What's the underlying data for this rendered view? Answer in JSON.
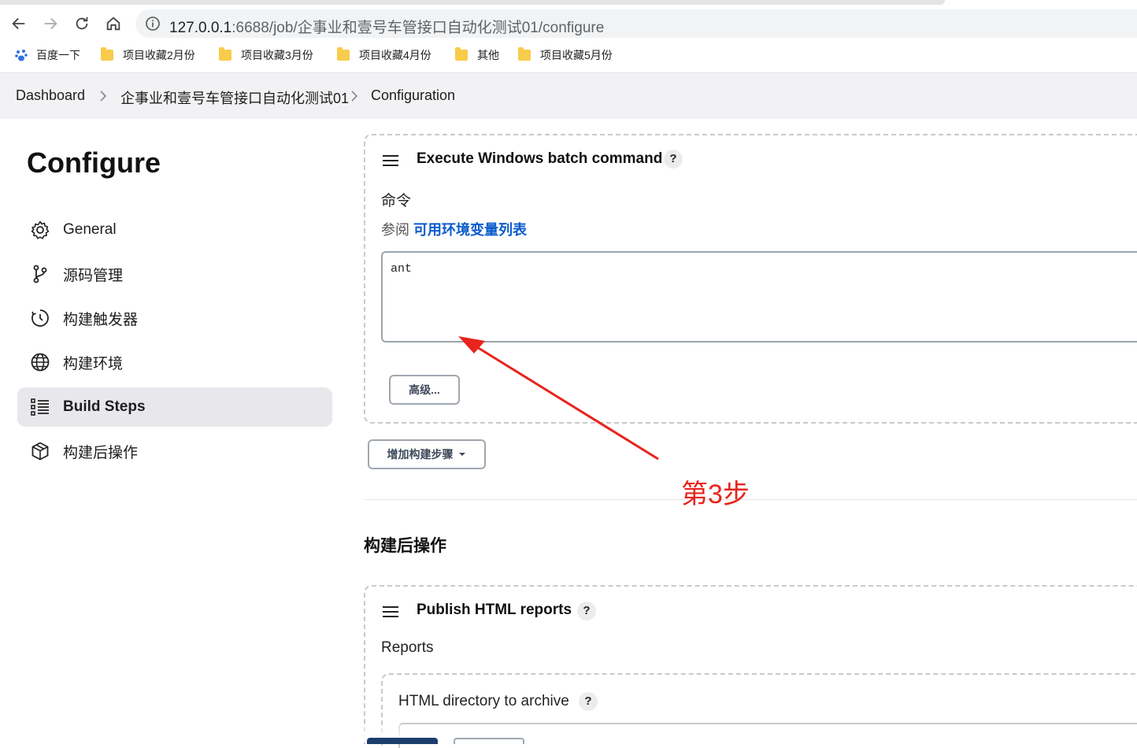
{
  "browser": {
    "url_host": "127.0.0.1",
    "url_rest": ":6688/job/企事业和壹号车管接口自动化测试01/configure",
    "bookmarks": [
      "百度一下",
      "项目收藏2月份",
      "项目收藏3月份",
      "项目收藏4月份",
      "其他",
      "项目收藏5月份"
    ]
  },
  "breadcrumb": [
    "Dashboard",
    "企事业和壹号车管接口自动化测试01",
    "Configuration"
  ],
  "sidebar": {
    "title": "Configure",
    "items": [
      {
        "label": "General",
        "icon": "gear-icon"
      },
      {
        "label": "源码管理",
        "icon": "branch-icon"
      },
      {
        "label": "构建触发器",
        "icon": "timer-icon"
      },
      {
        "label": "构建环境",
        "icon": "globe-icon"
      },
      {
        "label": "Build Steps",
        "icon": "list-icon",
        "active": true
      },
      {
        "label": "构建后操作",
        "icon": "package-icon"
      }
    ]
  },
  "build_step": {
    "title": "Execute Windows batch command",
    "help": "?",
    "command_label": "命令",
    "see_also_prefix": "参阅",
    "see_also_link": "可用环境变量列表",
    "command_value": "ant",
    "advanced_button": "高级...",
    "add_step_button": "增加构建步骤"
  },
  "post_build": {
    "section_title": "构建后操作",
    "card_title": "Publish HTML reports",
    "help": "?",
    "reports_label": "Reports",
    "dir_label": "HTML directory to archive",
    "dir_help": "?"
  },
  "annotation": {
    "text": "第3步",
    "color": "#e8241c"
  }
}
